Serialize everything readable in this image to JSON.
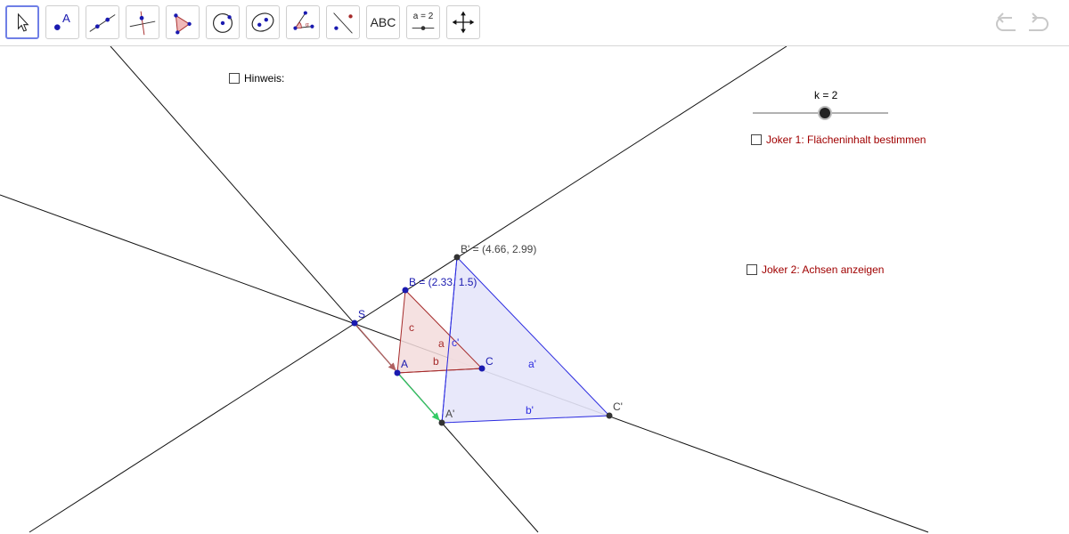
{
  "toolbar": {
    "tools": [
      {
        "name": "move-tool",
        "selected": true
      },
      {
        "name": "point-tool"
      },
      {
        "name": "line-tool"
      },
      {
        "name": "perpendicular-line-tool"
      },
      {
        "name": "polygon-tool"
      },
      {
        "name": "circle-tool"
      },
      {
        "name": "conic-tool"
      },
      {
        "name": "angle-tool"
      },
      {
        "name": "reflect-tool"
      },
      {
        "name": "text-tool",
        "label": "ABC"
      },
      {
        "name": "slider-tool",
        "label": "a = 2"
      },
      {
        "name": "move-graphics-view-tool"
      }
    ]
  },
  "checkboxes": {
    "hint": {
      "label": "Hinweis:",
      "checked": false
    },
    "joker1": {
      "label": "Joker 1: Flächeninhalt bestimmen",
      "checked": false
    },
    "joker2": {
      "label": "Joker 2: Achsen anzeigen",
      "checked": false
    }
  },
  "slider": {
    "label": "k = 2",
    "value": 2
  },
  "labels": {
    "S": "S",
    "A": "A",
    "B": "B = (2.33, 1.5)",
    "C": "C",
    "A_prime": "A'",
    "B_prime": "B' = (4.66, 2.99)",
    "C_prime": "C'",
    "a": "a",
    "b": "b",
    "c": "c",
    "a_prime": "a'",
    "b_prime": "b'",
    "c_prime": "c'"
  },
  "colors": {
    "triangle_small_stroke": "#a52a2a",
    "triangle_small_fill": "#f3dcdc",
    "triangle_large_stroke": "#2b2be0",
    "triangle_large_fill": "#e6e6fa",
    "point_blue": "#1a1ab0",
    "point_dark": "#333333",
    "line": "#111111",
    "vector_red": "#b06060",
    "vector_green": "#33cc66",
    "joker_text": "#a00000"
  }
}
